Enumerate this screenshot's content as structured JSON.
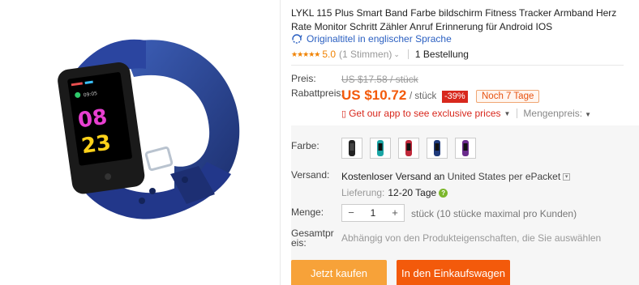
{
  "product": {
    "title": "LYKL 115 Plus Smart Band Farbe bildschirm Fitness Tracker Armband Herz Rate Monitor Schritt Zähler Anruf Erinnerung für Android IOS",
    "original_link": "Originaltitel in englischer Sprache",
    "rating_stars": "★★★★★",
    "rating_value": "5.0",
    "votes": "(1 Stimmen)",
    "orders": "1 Bestellung",
    "watch_time_display": "08 23",
    "accent_color": "#f35a0b"
  },
  "price": {
    "label": "Preis:",
    "old": "US $17.58 / stück",
    "discount_label": "Rabattpreis:",
    "new": "US $10.72",
    "per_piece": "/ stück",
    "discount": "-39%",
    "time_left": "Noch 7 Tage",
    "app_link": "Get our app to see exclusive prices",
    "bulk_label": "Mengenpreis:"
  },
  "color": {
    "label": "Farbe:",
    "options": [
      {
        "name": "black",
        "accent": "#444444"
      },
      {
        "name": "teal",
        "accent": "#1aa5a5"
      },
      {
        "name": "red",
        "accent": "#c0283a"
      },
      {
        "name": "navy",
        "accent": "#1f3a7a"
      },
      {
        "name": "purple",
        "accent": "#6a2b8c"
      }
    ]
  },
  "shipping": {
    "label": "Versand:",
    "free": "Kostenloser Versand an",
    "destination": "United States per ePacket",
    "delivery_label": "Lieferung:",
    "delivery_days": "12-20 Tage"
  },
  "quantity": {
    "label": "Menge:",
    "value": "1",
    "minus": "−",
    "plus": "+",
    "stock": "stück (10 stücke maximal pro Kunden)"
  },
  "total": {
    "label_line1": "Gesamtpr",
    "label_line2": "eis:",
    "text": "Abhängig von den Produkteigenschaften, die Sie auswählen"
  },
  "buttons": {
    "buy_now": "Jetzt kaufen",
    "add_to_cart": "In den Einkaufswagen"
  }
}
